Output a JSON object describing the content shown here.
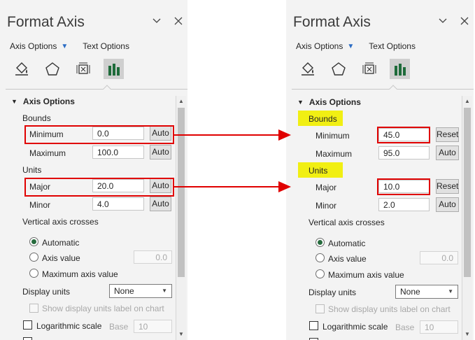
{
  "left": {
    "header": {
      "title": "Format Axis"
    },
    "subtabs": [
      "Axis Options",
      "Text Options"
    ],
    "section": "Axis Options",
    "bounds": {
      "label": "Bounds",
      "minimum": {
        "label": "Minimum",
        "value": "0.0",
        "button": "Auto"
      },
      "maximum": {
        "label": "Maximum",
        "value": "100.0",
        "button": "Auto"
      }
    },
    "units": {
      "label": "Units",
      "major": {
        "label": "Major",
        "value": "20.0",
        "button": "Auto"
      },
      "minor": {
        "label": "Minor",
        "value": "4.0",
        "button": "Auto"
      }
    },
    "crosses": {
      "label": "Vertical axis crosses",
      "options": [
        "Automatic",
        "Axis value",
        "Maximum axis value"
      ],
      "selected": "Automatic",
      "axis_value": "0.0"
    },
    "display_units": {
      "label": "Display units",
      "value": "None",
      "show_label": "Show display units label on chart"
    },
    "log": {
      "label": "Logarithmic scale",
      "base_label": "Base",
      "base_value": "10"
    }
  },
  "right": {
    "header": {
      "title": "Format Axis"
    },
    "subtabs": [
      "Axis Options",
      "Text Options"
    ],
    "section": "Axis Options",
    "bounds": {
      "label": "Bounds",
      "minimum": {
        "label": "Minimum",
        "value": "45.0",
        "button": "Reset"
      },
      "maximum": {
        "label": "Maximum",
        "value": "95.0",
        "button": "Auto"
      }
    },
    "units": {
      "label": "Units",
      "major": {
        "label": "Major",
        "value": "10.0",
        "button": "Reset"
      },
      "minor": {
        "label": "Minor",
        "value": "2.0",
        "button": "Auto"
      }
    },
    "crosses": {
      "label": "Vertical axis crosses",
      "options": [
        "Automatic",
        "Axis value",
        "Maximum axis value"
      ],
      "selected": "Automatic",
      "axis_value": "0.0"
    },
    "display_units": {
      "label": "Display units",
      "value": "None",
      "show_label": "Show display units label on chart"
    },
    "log": {
      "label": "Logarithmic scale",
      "base_label": "Base",
      "base_value": "10"
    }
  },
  "icons": [
    "fill-line-icon",
    "effects-icon",
    "size-properties-icon",
    "axis-options-icon",
    "chevron-down-icon",
    "close-icon"
  ],
  "colors": {
    "annotation_red": "#e00000",
    "highlight_yellow": "#f1ef13",
    "radio_green": "#266b3d",
    "subtab_blue": "#2b6cc4"
  }
}
